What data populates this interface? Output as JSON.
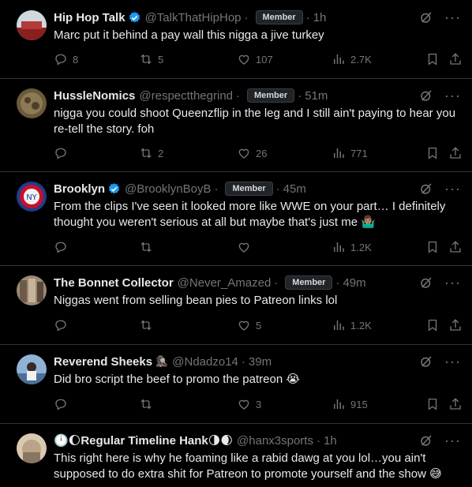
{
  "tweets": [
    {
      "name": "Hip Hop Talk",
      "verified": true,
      "handle": "@TalkThatHipHop",
      "member": "Member",
      "time": "1h",
      "text": "Marc put it behind a pay wall this nigga a jive turkey",
      "replies": "8",
      "retweets": "5",
      "likes": "107",
      "views": "2.7K",
      "avatar_color": "#8a1f1f"
    },
    {
      "name": "HussleNomics",
      "verified": false,
      "handle": "@respectthegrind",
      "member": "Member",
      "time": "51m",
      "text": "nigga you could shoot Queenzflip in the leg and I still ain't paying to hear you re-tell the story. foh",
      "replies": "",
      "retweets": "2",
      "likes": "26",
      "views": "771",
      "avatar_color": "#6b5a3a"
    },
    {
      "name": "Brooklyn",
      "verified": true,
      "handle": "@BrooklynBoyB",
      "member": "Member",
      "time": "45m",
      "text": "From the clips I've seen it looked more like WWE on your part… I definitely thought you weren't serious at all but maybe that's just me 🤷🏽‍♂️",
      "replies": "",
      "retweets": "",
      "likes": "",
      "views": "1.2K",
      "avatar_color": "#1d3f8a"
    },
    {
      "name": "The Bonnet Collector",
      "verified": false,
      "handle": "@Never_Amazed",
      "member": "Member",
      "time": "49m",
      "text": "Niggas went from selling bean pies to Patreon links lol",
      "replies": "",
      "retweets": "",
      "likes": "5",
      "views": "1.2K",
      "avatar_color": "#9b8a76"
    },
    {
      "name": "Reverend Sheeks",
      "verified": false,
      "handle": "@Ndadzo14",
      "member": "",
      "time": "39m",
      "name_emoji": "🕵🏿",
      "text": "Did bro script the beef to promo the patreon 😭",
      "replies": "",
      "retweets": "",
      "likes": "3",
      "views": "915",
      "avatar_color": "#4a6f9a"
    },
    {
      "name": "🕛🌔Regular Timeline Hank🌗🌒",
      "verified": false,
      "handle": "@hanx3sports",
      "member": "",
      "time": "1h",
      "text": "This right here is why he foaming like a rabid dawg at you lol…you ain't supposed to do extra shit for Patreon to promote yourself and the show 😅",
      "replies": "",
      "retweets": "",
      "likes": "",
      "views": "",
      "avatar_color": "#b9a48a"
    }
  ],
  "colors": {
    "bg": "#000000",
    "text": "#e7e9ea",
    "muted": "#71767b",
    "border": "#2f3336",
    "verified": "#1d9bf0"
  },
  "icons": [
    "reply-icon",
    "retweet-icon",
    "like-icon",
    "views-icon",
    "bookmark-icon",
    "share-icon",
    "grok-icon",
    "more-icon",
    "verified-badge-icon"
  ]
}
